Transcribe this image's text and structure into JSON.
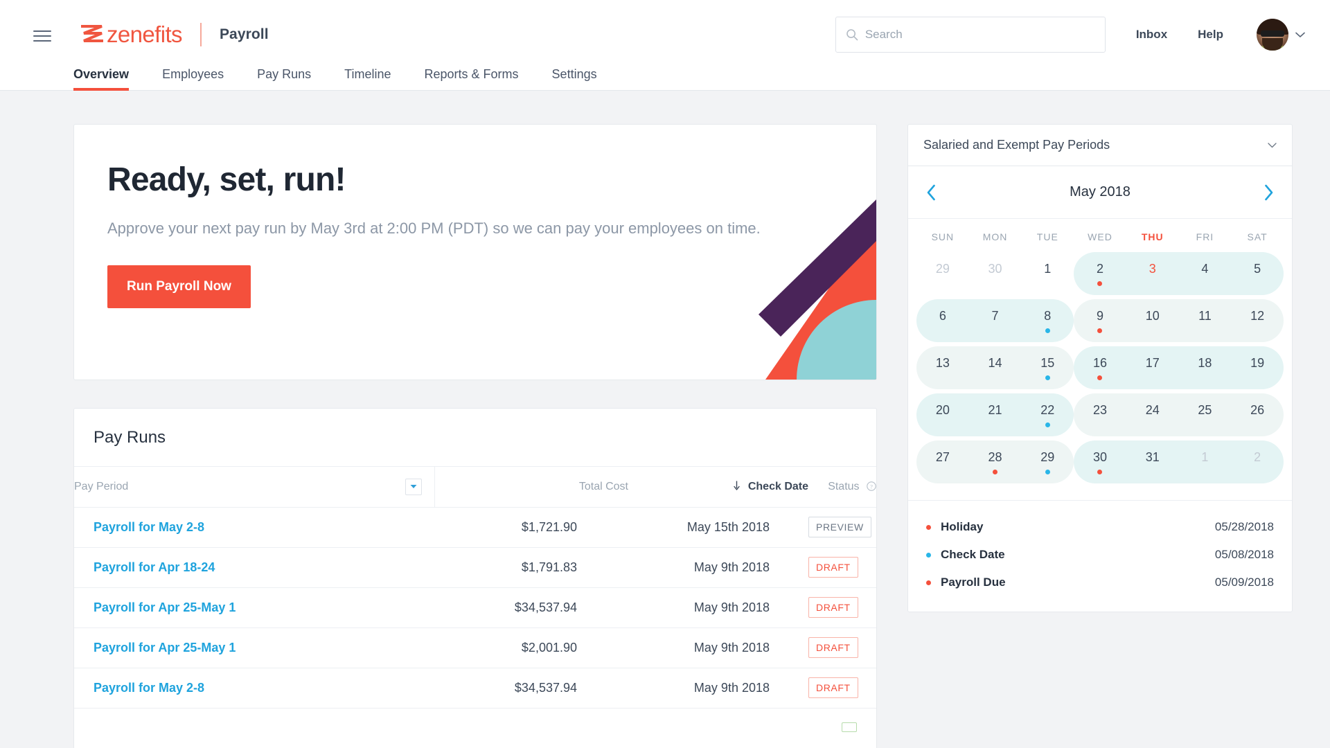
{
  "header": {
    "menu_icon": "hamburger-icon",
    "brand": "zenefits",
    "app": "Payroll",
    "search": {
      "placeholder": "Search",
      "value": "",
      "icon": "search-icon"
    },
    "inbox": "Inbox",
    "help": "Help",
    "account_caret": "chevron-down-icon"
  },
  "nav": {
    "tabs": [
      {
        "label": "Overview",
        "active": true
      },
      {
        "label": "Employees",
        "active": false
      },
      {
        "label": "Pay Runs",
        "active": false
      },
      {
        "label": "Timeline",
        "active": false
      },
      {
        "label": "Reports & Forms",
        "active": false
      },
      {
        "label": "Settings",
        "active": false
      }
    ]
  },
  "hero": {
    "title": "Ready, set, run!",
    "subtitle": "Approve your next pay run by May 3rd at 2:00 PM (PDT) so we can pay your employees on time.",
    "cta": "Run Payroll Now"
  },
  "payruns": {
    "title": "Pay Runs",
    "columns": {
      "period": "Pay Period",
      "cost": "Total Cost",
      "date": "Check Date",
      "status": "Status"
    },
    "sort_indicator": "down-arrow-icon",
    "filter_icon": "filter-caret-icon",
    "status_info_icon": "info-icon",
    "rows": [
      {
        "period": "Payroll for May 2-8",
        "cost": "$1,721.90",
        "date": "May 15th 2018",
        "status": "PREVIEW",
        "status_kind": "preview"
      },
      {
        "period": "Payroll for Apr 18-24",
        "cost": "$1,791.83",
        "date": "May 9th 2018",
        "status": "DRAFT",
        "status_kind": "draft"
      },
      {
        "period": "Payroll for Apr 25-May 1",
        "cost": "$34,537.94",
        "date": "May 9th 2018",
        "status": "DRAFT",
        "status_kind": "draft"
      },
      {
        "period": "Payroll for Apr 25-May 1",
        "cost": "$2,001.90",
        "date": "May 9th 2018",
        "status": "DRAFT",
        "status_kind": "draft"
      },
      {
        "period": "Payroll for May 2-8",
        "cost": "$34,537.94",
        "date": "May 9th 2018",
        "status": "DRAFT",
        "status_kind": "draft"
      },
      {
        "period": "",
        "cost": "",
        "date": "",
        "status": "",
        "status_kind": "approved"
      }
    ]
  },
  "calendar": {
    "selected_period": "Salaried and Exempt Pay Periods",
    "prev_icon": "chevron-left-icon",
    "next_icon": "chevron-right-icon",
    "month": "May 2018",
    "dow": [
      "SUN",
      "MON",
      "TUE",
      "WED",
      "THU",
      "FRI",
      "SAT"
    ],
    "highlight_dow": "THU",
    "weeks": [
      {
        "bands": [
          {
            "start": 3,
            "end": 6,
            "shade": "dark"
          }
        ],
        "days": [
          {
            "n": "29",
            "muted": true
          },
          {
            "n": "30",
            "muted": true
          },
          {
            "n": "1"
          },
          {
            "n": "2",
            "dot": "red"
          },
          {
            "n": "3",
            "today": true
          },
          {
            "n": "4"
          },
          {
            "n": "5"
          }
        ]
      },
      {
        "bands": [
          {
            "start": 0,
            "end": 2,
            "shade": "dark"
          },
          {
            "start": 3,
            "end": 6,
            "shade": "light"
          }
        ],
        "days": [
          {
            "n": "6"
          },
          {
            "n": "7"
          },
          {
            "n": "8",
            "dot": "blue"
          },
          {
            "n": "9",
            "dot": "red"
          },
          {
            "n": "10"
          },
          {
            "n": "11"
          },
          {
            "n": "12"
          }
        ]
      },
      {
        "bands": [
          {
            "start": 0,
            "end": 2,
            "shade": "light"
          },
          {
            "start": 3,
            "end": 6,
            "shade": "dark"
          }
        ],
        "days": [
          {
            "n": "13"
          },
          {
            "n": "14"
          },
          {
            "n": "15",
            "dot": "blue"
          },
          {
            "n": "16",
            "dot": "red"
          },
          {
            "n": "17"
          },
          {
            "n": "18"
          },
          {
            "n": "19"
          }
        ]
      },
      {
        "bands": [
          {
            "start": 0,
            "end": 2,
            "shade": "dark"
          },
          {
            "start": 3,
            "end": 6,
            "shade": "light"
          }
        ],
        "days": [
          {
            "n": "20"
          },
          {
            "n": "21"
          },
          {
            "n": "22",
            "dot": "blue"
          },
          {
            "n": "23"
          },
          {
            "n": "24"
          },
          {
            "n": "25"
          },
          {
            "n": "26"
          }
        ]
      },
      {
        "bands": [
          {
            "start": 0,
            "end": 2,
            "shade": "light"
          },
          {
            "start": 3,
            "end": 6,
            "shade": "dark"
          }
        ],
        "days": [
          {
            "n": "27"
          },
          {
            "n": "28",
            "dot": "red"
          },
          {
            "n": "29",
            "dot": "blue"
          },
          {
            "n": "30",
            "dot": "red"
          },
          {
            "n": "31"
          },
          {
            "n": "1",
            "muted": true
          },
          {
            "n": "2",
            "muted": true
          }
        ]
      }
    ],
    "legend": [
      {
        "name": "Holiday",
        "date": "05/28/2018",
        "color": "red"
      },
      {
        "name": "Check Date",
        "date": "05/08/2018",
        "color": "blue"
      },
      {
        "name": "Payroll Due",
        "date": "05/09/2018",
        "color": "red"
      }
    ]
  },
  "colors": {
    "brand_red": "#f4503c",
    "link_blue": "#1fa3dd",
    "dot_blue": "#29b6e8",
    "band_teal": "#e4f4f4",
    "page_bg": "#f2f3f5"
  }
}
